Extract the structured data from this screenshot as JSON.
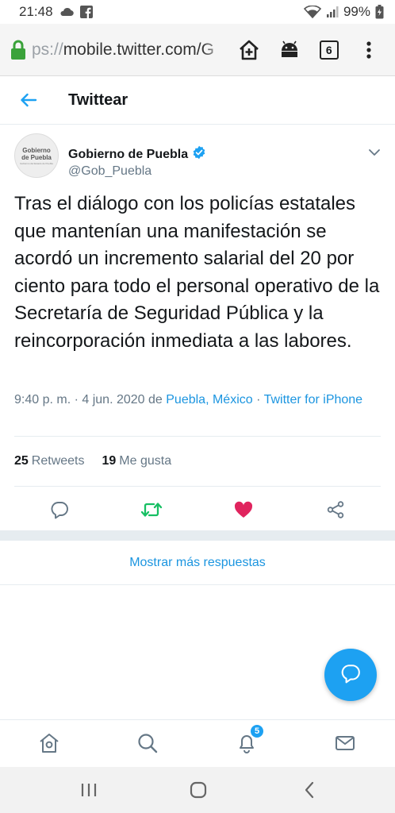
{
  "status_bar": {
    "time": "21:48",
    "battery": "99%",
    "icons": [
      "cloud-icon",
      "facebook-icon",
      "wifi-icon",
      "signal-icon",
      "battery-icon"
    ]
  },
  "browser": {
    "url_prefix": "ps://",
    "url": "mobile.twitter.com/G",
    "tab_count": "6",
    "icons": [
      "lock-icon",
      "home-add-icon",
      "android-icon",
      "tabs-icon",
      "more-vert-icon"
    ]
  },
  "header": {
    "title": "Twittear"
  },
  "tweet": {
    "author": {
      "name": "Gobierno de Puebla",
      "handle": "@Gob_Puebla",
      "avatar_line1": "Gobierno",
      "avatar_line2": "de Puebla",
      "avatar_small": "Gobierno del Estado de Puebla",
      "verified": true
    },
    "text": "Tras el diálogo con los policías estatales que mantenían una manifestación se acordó un incremento salarial del 20 por ciento para todo el personal operativo de la Secretaría de Seguridad Pública y la reincorporación inmediata a las labores.",
    "meta": {
      "time": "9:40 p. m.",
      "sep1": " · ",
      "date": "4 jun. 2020",
      "from": " de ",
      "place": "Puebla, México",
      "sep2": " · ",
      "source": "Twitter for iPhone"
    },
    "stats": {
      "retweets_count": "25",
      "retweets_label": "Retweets",
      "likes_count": "19",
      "likes_label": "Me gusta"
    }
  },
  "more_replies": "Mostrar más respuestas",
  "bottom_nav": {
    "notifications_badge": "5"
  },
  "colors": {
    "twitter_blue": "#1da1f2",
    "link_blue": "#1b95e0",
    "retweet_green": "#17bf63",
    "like_red": "#e0245e",
    "secure_green": "#3aa23a"
  }
}
